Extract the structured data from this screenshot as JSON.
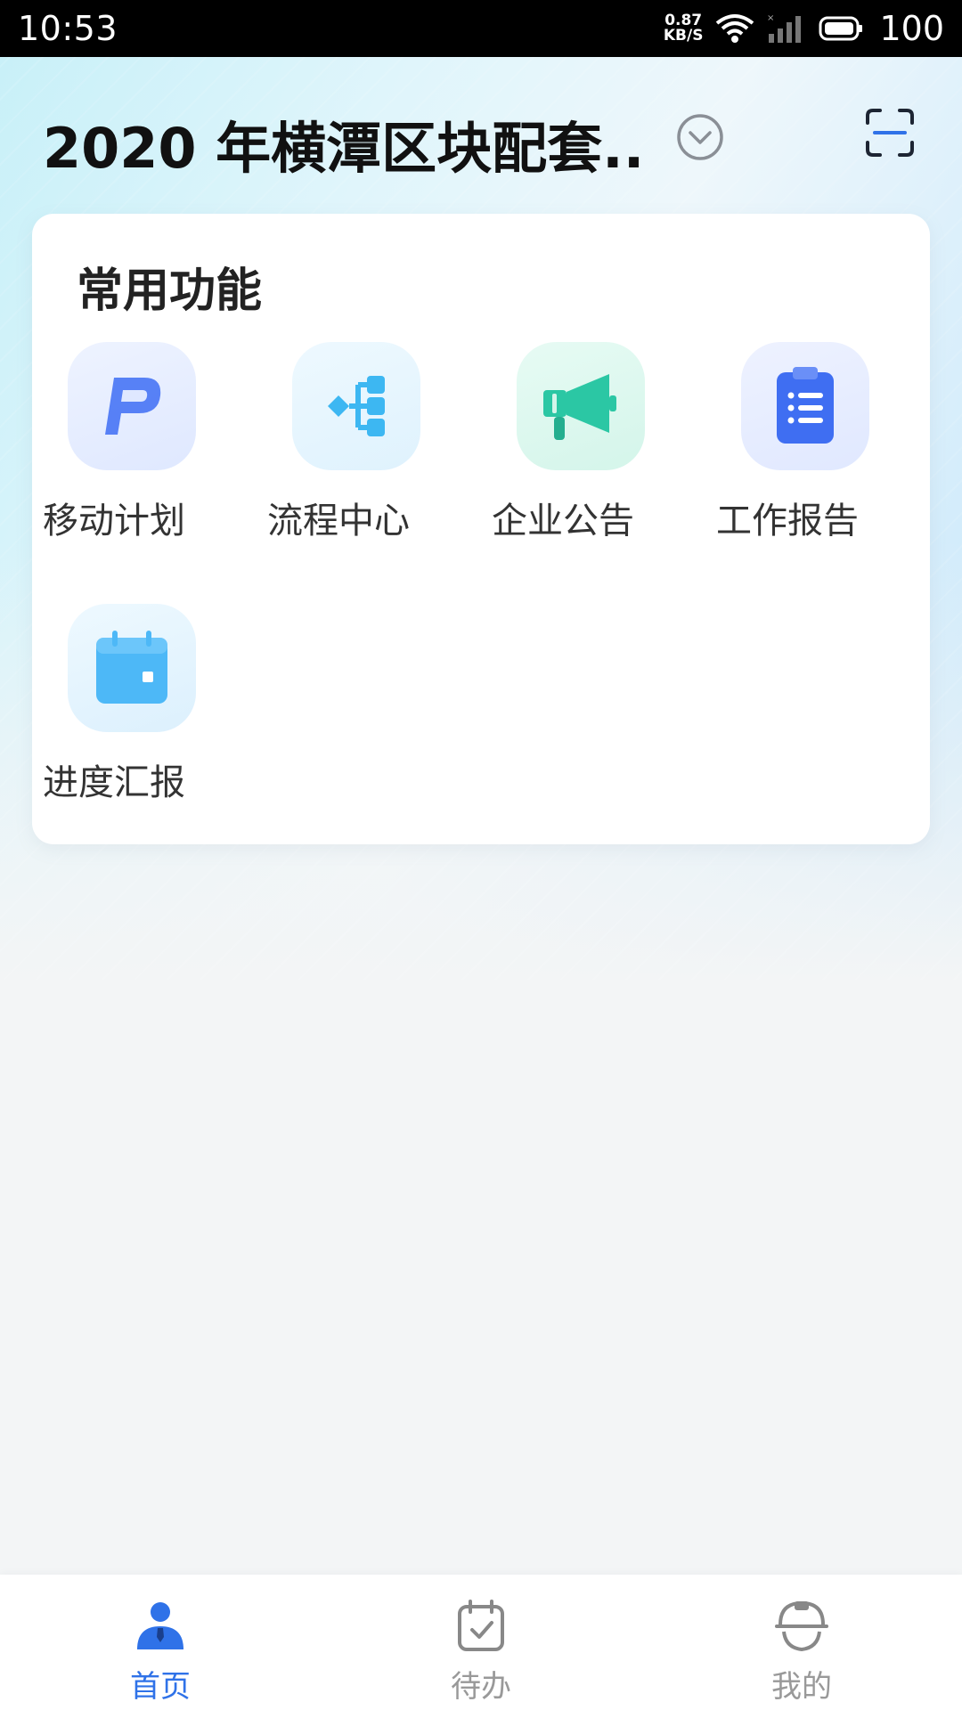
{
  "status_bar": {
    "time": "10:53",
    "net_speed_value": "0.87",
    "net_speed_unit": "KB/S",
    "battery": "100"
  },
  "header": {
    "title": "2020 年横潭区块配套...",
    "dropdown_icon": "chevron-down-circle-icon",
    "scan_icon": "scan-icon"
  },
  "common_functions": {
    "title": "常用功能",
    "items": [
      {
        "label": "移动计划",
        "icon": "p-logo-icon",
        "color": "#4f7af5"
      },
      {
        "label": "流程中心",
        "icon": "flow-icon",
        "color": "#3db7f2"
      },
      {
        "label": "企业公告",
        "icon": "megaphone-icon",
        "color": "#2bc7a4"
      },
      {
        "label": "工作报告",
        "icon": "clipboard-icon",
        "color": "#3f6ef2"
      },
      {
        "label": "进度汇报",
        "icon": "calendar-icon",
        "color": "#4db8f7"
      }
    ]
  },
  "bottom_nav": {
    "items": [
      {
        "label": "首页",
        "icon": "home-user-icon",
        "active": true
      },
      {
        "label": "待办",
        "icon": "todo-calendar-icon",
        "active": false
      },
      {
        "label": "我的",
        "icon": "helmet-icon",
        "active": false
      }
    ],
    "active_color": "#2f72e8",
    "inactive_color": "#999999"
  }
}
